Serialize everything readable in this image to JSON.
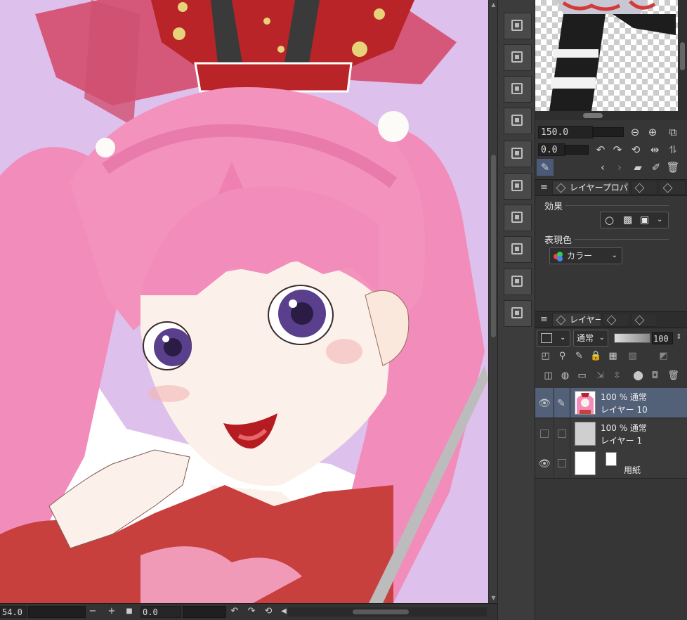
{
  "status_bar": {
    "zoom_value": "54.0",
    "zoom_out_label": "−",
    "zoom_in_label": "+",
    "fit_icon": "stop-square-icon",
    "angle_value": "0.0",
    "rotate_left_icon": "rotate-left-icon",
    "rotate_right_icon": "rotate-right-icon",
    "reset_rotation_icon": "reset-rotation-icon",
    "scroll_left_icon": "chevron-left-icon"
  },
  "tool_strip": {
    "buttons": [
      {
        "icon": "layer-delete-icon"
      },
      {
        "icon": "layer-new-icon"
      },
      {
        "icon": "layer-clear-icon"
      },
      {
        "icon": "layer-tone-icon"
      },
      {
        "icon": "layer-transform-icon"
      },
      {
        "icon": "layer-frame-icon"
      },
      {
        "icon": "layer-new-raster-icon"
      },
      {
        "icon": "layer-grid-icon"
      },
      {
        "icon": "layer-clip-icon"
      },
      {
        "icon": "layer-reference-icon"
      }
    ]
  },
  "navigator": {
    "zoom_value": "150.0",
    "angle_value": "0.0",
    "zoom_out_icon": "minus-circle-icon",
    "zoom_in_icon": "plus-circle-icon",
    "fit_icon": "fit-window-icon",
    "rotate_left_icon": "rotate-left-icon",
    "rotate_right_icon": "rotate-right-icon",
    "reset_icon": "reset-rotation-icon",
    "flip_h_icon": "flip-horizontal-icon",
    "flip_v_icon": "flip-vertical-icon",
    "eyedropper_icon": "eyedropper-icon",
    "prev_icon": "chevron-left-icon",
    "next_icon": "chevron-right-icon",
    "folder_icon": "folder-open-icon",
    "edit_icon": "edit-icon",
    "trash_icon": "trash-icon"
  },
  "properties_panel": {
    "tab_label": "レイヤープロパテ",
    "effect_label": "効果",
    "expression_color_label": "表現色",
    "color_select_value": "カラー"
  },
  "layer_panel": {
    "tab_label": "レイヤー",
    "blend_mode": "通常",
    "opacity_value": "100",
    "layers": [
      {
        "line1": "100 % 通常",
        "line2": "レイヤー 10",
        "visible": true,
        "selected": true
      },
      {
        "line1": "100 % 通常",
        "line2": "レイヤー 1",
        "visible": false,
        "selected": false
      },
      {
        "line1": "",
        "line2": "用紙",
        "visible": true,
        "selected": false
      }
    ]
  },
  "colors": {
    "hair": "#f28cba",
    "crown": "#b82428",
    "dress": "#c8403e",
    "background_purple": "#ddc1ec",
    "selected_layer": "#526078"
  }
}
